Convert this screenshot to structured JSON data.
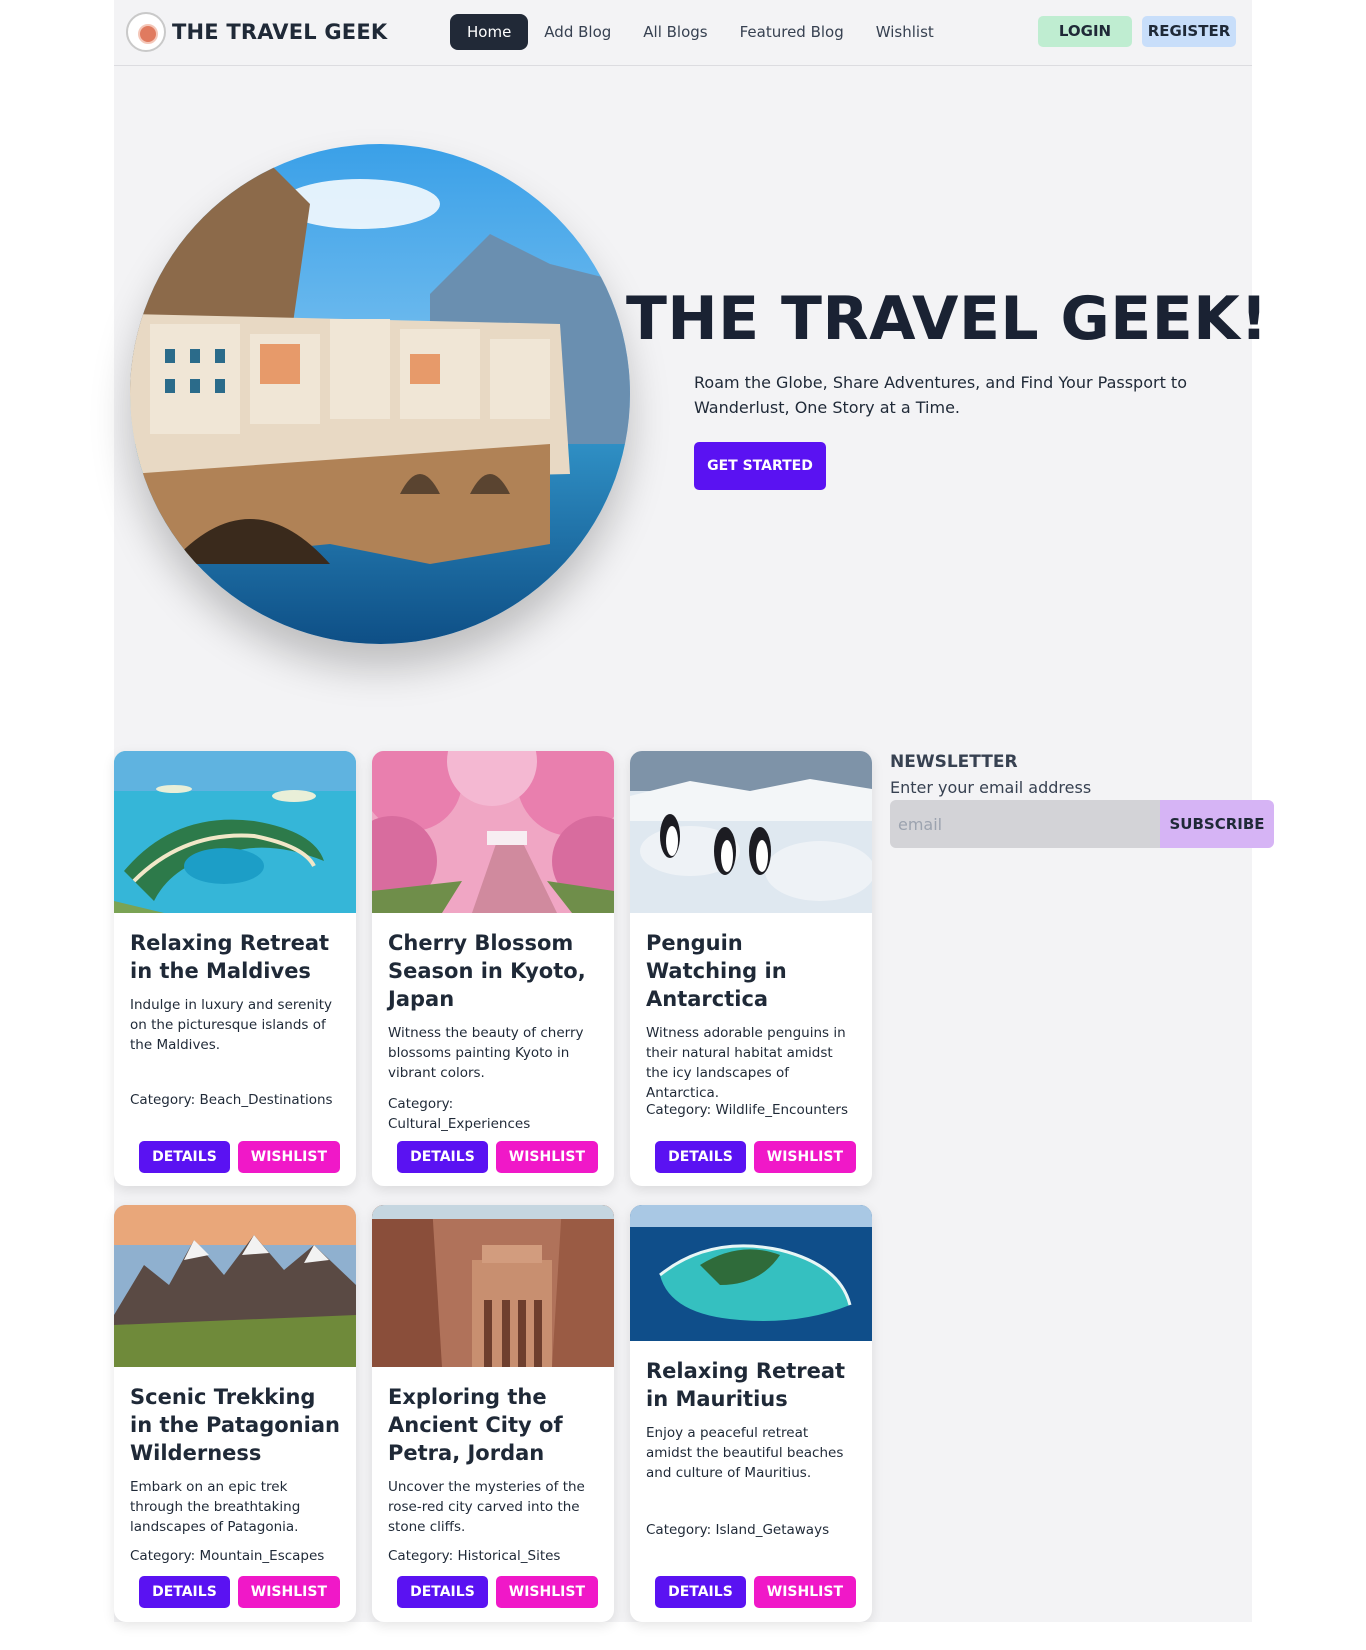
{
  "navbar": {
    "brand": "THE TRAVEL GEEK",
    "links": [
      "Home",
      "Add Blog",
      "All Blogs",
      "Featured Blog",
      "Wishlist"
    ],
    "login": "LOGIN",
    "register": "REGISTER"
  },
  "hero": {
    "title": "THE TRAVEL GEEK!",
    "subtitle": "Roam the Globe, Share Adventures, and Find Your Passport to Wanderlust, One Story at a Time.",
    "cta": "GET STARTED"
  },
  "blogs": [
    {
      "title": "Relaxing Retreat in the Maldives",
      "description": "Indulge in luxury and serenity on the picturesque islands of the Maldives.",
      "category": "Category: Beach_Destinations"
    },
    {
      "title": "Cherry Blossom Season in Kyoto, Japan",
      "description": "Witness the beauty of cherry blossoms painting Kyoto in vibrant colors.",
      "category": "Category: Cultural_Experiences"
    },
    {
      "title": "Penguin Watching in Antarctica",
      "description": "Witness adorable penguins in their natural habitat amidst the icy landscapes of Antarctica.",
      "category": "Category: Wildlife_Encounters"
    },
    {
      "title": "Scenic Trekking in the Patagonian Wilderness",
      "description": "Embark on an epic trek through the breathtaking landscapes of Patagonia.",
      "category": "Category: Mountain_Escapes"
    },
    {
      "title": "Exploring the Ancient City of Petra, Jordan",
      "description": "Uncover the mysteries of the rose-red city carved into the stone cliffs.",
      "category": "Category: Historical_Sites"
    },
    {
      "title": "Relaxing Retreat in Mauritius",
      "description": "Enjoy a peaceful retreat amidst the beautiful beaches and culture of Mauritius.",
      "category": "Category: Island_Getaways"
    }
  ],
  "card_actions": {
    "details": "DETAILS",
    "wishlist": "WISHLIST"
  },
  "newsletter": {
    "title": "NEWSLETTER",
    "label": "Enter your email address",
    "placeholder": "email",
    "button": "SUBSCRIBE"
  },
  "colors": {
    "primary": "#5a12f2",
    "wishlist": "#f018c8",
    "login_bg": "#bfedd1",
    "register_bg": "#c8defa",
    "subscribe_bg": "#d6b4f5",
    "nav_active": "#212937"
  }
}
